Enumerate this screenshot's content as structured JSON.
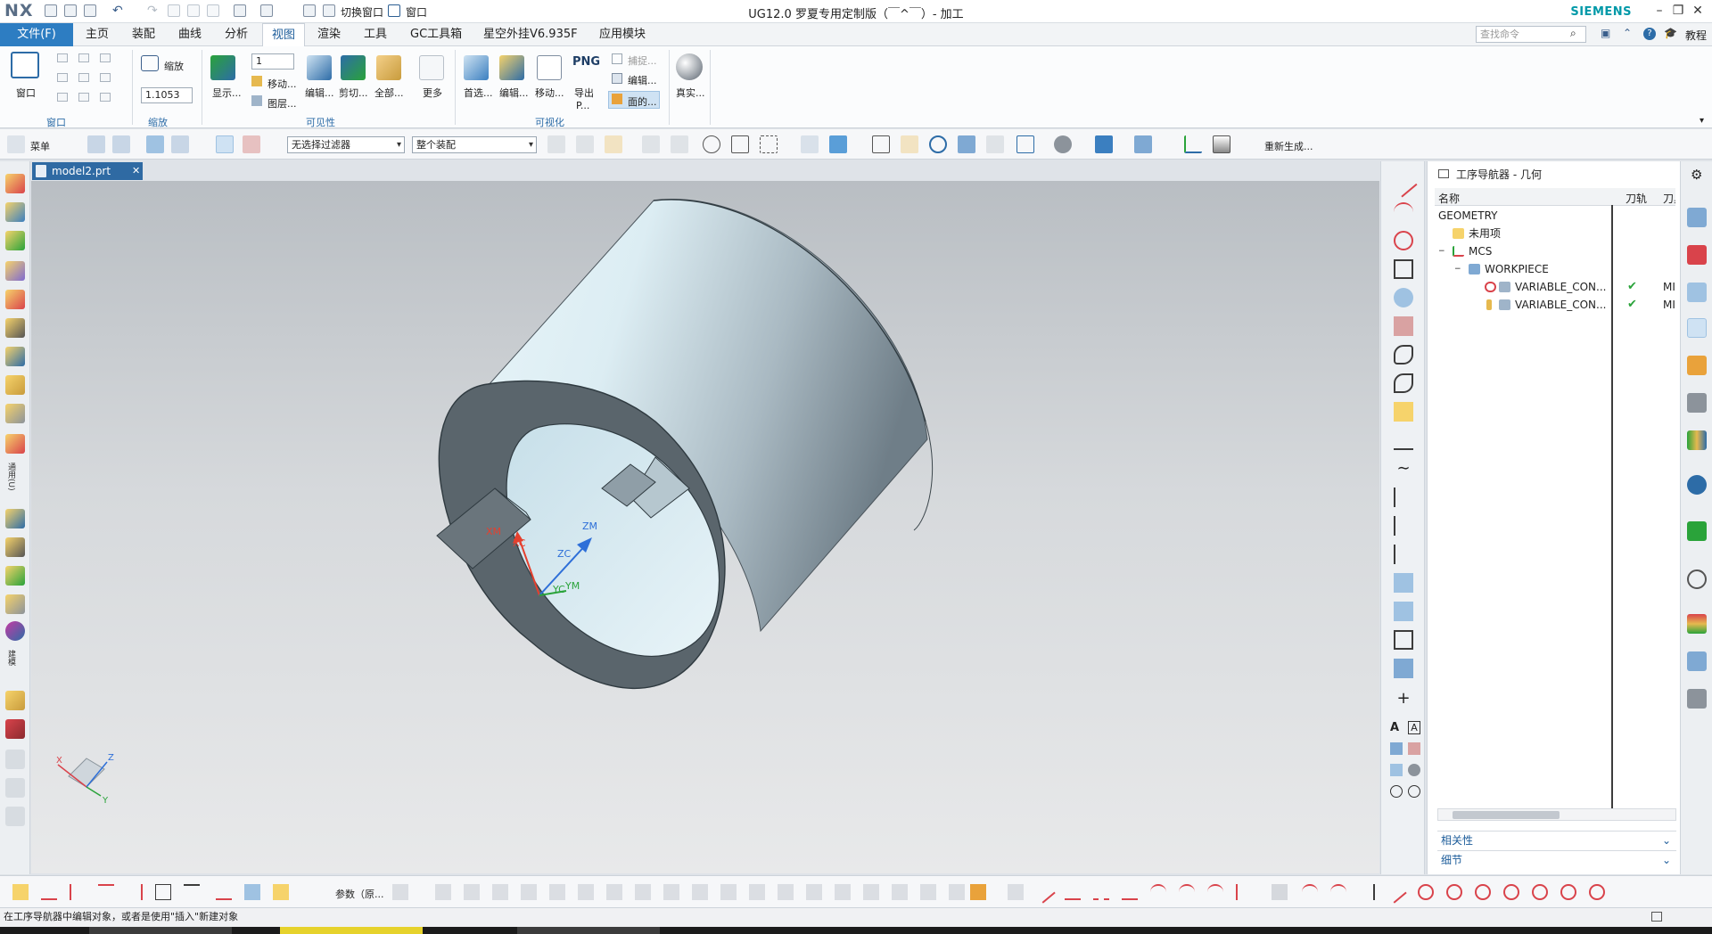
{
  "titlebar": {
    "logo": "NX",
    "switch_window": "切换窗口",
    "window_menu": "窗口",
    "title": "UG12.0 罗夏专用定制版（￣^￣）- 加工",
    "brand": "SIEMENS"
  },
  "menubar": {
    "file": "文件(F)",
    "tabs": [
      "主页",
      "装配",
      "曲线",
      "分析",
      "视图",
      "渲染",
      "工具",
      "GC工具箱",
      "星空外挂V6.935F",
      "应用模块"
    ],
    "active_tab": "视图",
    "search_placeholder": "查找命令",
    "help": "教程"
  },
  "ribbon": {
    "window_label": "窗口",
    "zoom_label": "缩放",
    "zoom_value": "1.1053",
    "layer_value": "1",
    "show_label": "显示...",
    "move_label": "移动...",
    "layer_label": "图层...",
    "edit_label": "编辑...",
    "cut_label": "剪切...",
    "all_label": "全部...",
    "more_label": "更多",
    "pref_label": "首选...",
    "edit2_label": "编辑...",
    "move2_label": "移动...",
    "export_label": "导出",
    "export_sub": "P...",
    "png_label": "PNG",
    "capture_label": "捕捉...",
    "edit3_label": "编辑...",
    "face_label": "面的...",
    "real_label": "真实...",
    "groups": {
      "window": "窗口",
      "zoom": "缩放",
      "visibility": "可见性",
      "visualization": "可视化"
    }
  },
  "toolbar2": {
    "menu_label": "菜单",
    "filter": "无选择过滤器",
    "assembly": "整个装配",
    "regen": "重新生成..."
  },
  "leftbar": {
    "label_a": "通用(U)",
    "label_b": "建模"
  },
  "document": {
    "tab": "model2.prt"
  },
  "viewport": {
    "axis_labels": {
      "xm": "XM",
      "xc": "XC",
      "zc": "ZC",
      "zm": "ZM",
      "yc": "YC",
      "ym": "YM"
    },
    "triad": {
      "x": "X",
      "y": "Y",
      "z": "Z"
    }
  },
  "navigator": {
    "title": "工序导航器 - 几何",
    "columns": [
      "名称",
      "刀轨",
      "刀具"
    ],
    "rows": [
      {
        "name": "GEOMETRY",
        "level": 0,
        "toolpath": "",
        "tool": ""
      },
      {
        "name": "未用项",
        "level": 1,
        "toolpath": "",
        "tool": ""
      },
      {
        "name": "MCS",
        "level": 1,
        "toolpath": "",
        "tool": ""
      },
      {
        "name": "WORKPIECE",
        "level": 2,
        "toolpath": "",
        "tool": ""
      },
      {
        "name": "VARIABLE_CON...",
        "level": 3,
        "toolpath": "✔",
        "tool": "MI"
      },
      {
        "name": "VARIABLE_CON...",
        "level": 3,
        "toolpath": "✔",
        "tool": "MI"
      }
    ],
    "panels": [
      "相关性",
      "细节"
    ]
  },
  "bottombar": {
    "params_label": "参数（原..."
  },
  "statusbar": {
    "message": "在工序导航器中编辑对象，或者是使用\"插入\"新建对象"
  },
  "colors": {
    "accent": "#2d7dc2",
    "viewport_top": "#b9bec3",
    "viewport_bottom": "#e8e9ea",
    "solid_light": "#dfeff5",
    "solid_dark": "#4f5a63"
  }
}
